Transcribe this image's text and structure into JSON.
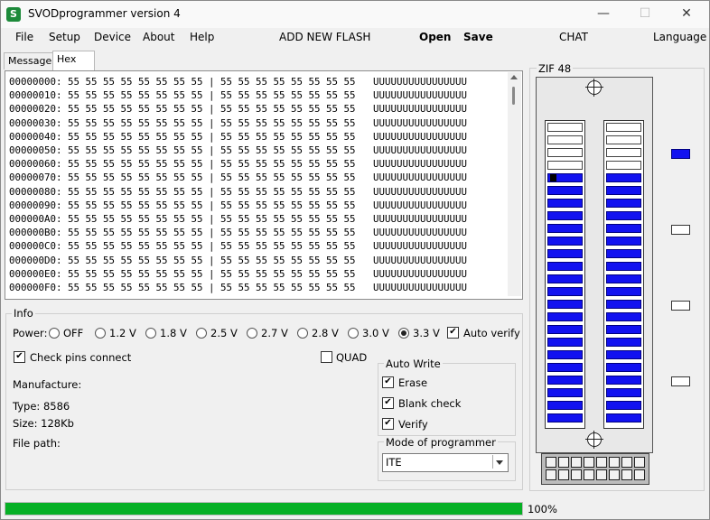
{
  "window": {
    "title": "SVODprogrammer version 4",
    "icon_letter": "S",
    "minimize": "—",
    "maximize": "☐",
    "close": "✕"
  },
  "menu": {
    "file": "File",
    "setup": "Setup",
    "device": "Device",
    "about": "About",
    "help": "Help",
    "add_new_flash": "ADD NEW FLASH",
    "open": "Open",
    "save": "Save",
    "chat": "CHAT",
    "language": "Language"
  },
  "tabs": {
    "message": "Message",
    "hex_viewer": "Hex Viewer"
  },
  "hex_rows": [
    "00000000: 55 55 55 55 55 55 55 55 | 55 55 55 55 55 55 55 55   UUUUUUUUUUUUUUUU",
    "00000010: 55 55 55 55 55 55 55 55 | 55 55 55 55 55 55 55 55   UUUUUUUUUUUUUUUU",
    "00000020: 55 55 55 55 55 55 55 55 | 55 55 55 55 55 55 55 55   UUUUUUUUUUUUUUUU",
    "00000030: 55 55 55 55 55 55 55 55 | 55 55 55 55 55 55 55 55   UUUUUUUUUUUUUUUU",
    "00000040: 55 55 55 55 55 55 55 55 | 55 55 55 55 55 55 55 55   UUUUUUUUUUUUUUUU",
    "00000050: 55 55 55 55 55 55 55 55 | 55 55 55 55 55 55 55 55   UUUUUUUUUUUUUUUU",
    "00000060: 55 55 55 55 55 55 55 55 | 55 55 55 55 55 55 55 55   UUUUUUUUUUUUUUUU",
    "00000070: 55 55 55 55 55 55 55 55 | 55 55 55 55 55 55 55 55   UUUUUUUUUUUUUUUU",
    "00000080: 55 55 55 55 55 55 55 55 | 55 55 55 55 55 55 55 55   UUUUUUUUUUUUUUUU",
    "00000090: 55 55 55 55 55 55 55 55 | 55 55 55 55 55 55 55 55   UUUUUUUUUUUUUUUU",
    "000000A0: 55 55 55 55 55 55 55 55 | 55 55 55 55 55 55 55 55   UUUUUUUUUUUUUUUU",
    "000000B0: 55 55 55 55 55 55 55 55 | 55 55 55 55 55 55 55 55   UUUUUUUUUUUUUUUU",
    "000000C0: 55 55 55 55 55 55 55 55 | 55 55 55 55 55 55 55 55   UUUUUUUUUUUUUUUU",
    "000000D0: 55 55 55 55 55 55 55 55 | 55 55 55 55 55 55 55 55   UUUUUUUUUUUUUUUU",
    "000000E0: 55 55 55 55 55 55 55 55 | 55 55 55 55 55 55 55 55   UUUUUUUUUUUUUUUU",
    "000000F0: 55 55 55 55 55 55 55 55 | 55 55 55 55 55 55 55 55   UUUUUUUUUUUUUUUU"
  ],
  "info": {
    "legend": "Info",
    "power_label": "Power:",
    "power_options": [
      "OFF",
      "1.2 V",
      "1.8 V",
      "2.5 V",
      "2.7 V",
      "2.8 V",
      "3.0 V",
      "3.3 V"
    ],
    "power_selected": "3.3 V",
    "auto_verify": "Auto verify",
    "auto_verify_checked": true,
    "check_pins": "Check pins connect",
    "check_pins_checked": true,
    "quad": "QUAD",
    "quad_checked": false,
    "manufacture": "Manufacture:",
    "type": "Type: 8586",
    "size": "Size: 128Kb",
    "file_path": "File path:"
  },
  "auto_write": {
    "legend": "Auto Write",
    "erase": "Erase",
    "blank_check": "Blank check",
    "verify": "Verify",
    "erase_checked": true,
    "blank_check_checked": true,
    "verify_checked": true
  },
  "mode": {
    "legend": "Mode of programmer",
    "value": "ITE"
  },
  "zif": {
    "legend": "ZIF 48",
    "pins_per_side": 24,
    "empty_top_pins": 4,
    "pin1_marker_color": "#000000",
    "active_color": "#1212f0",
    "side_indicators": [
      true,
      false,
      false,
      false
    ]
  },
  "progress": {
    "value": 1.0,
    "label": "100%",
    "color": "#06b025"
  }
}
